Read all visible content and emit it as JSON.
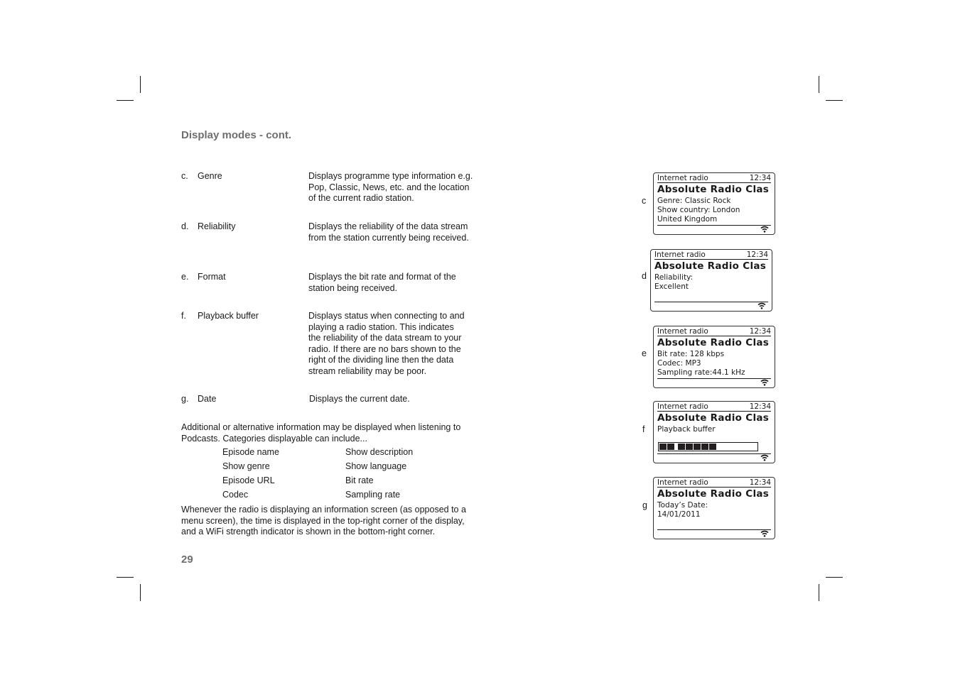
{
  "section_title": "Display modes - cont.",
  "entries": [
    {
      "letter": "c.",
      "term": "Genre",
      "description": "Displays programme type information e.g. Pop, Classic, News, etc. and the location of the current radio station."
    },
    {
      "letter": "d.",
      "term": "Reliability",
      "description": "Displays the reliability of the data stream from the station currently being received."
    },
    {
      "letter": "e.",
      "term": "Format",
      "description": "Displays the bit rate and format of the station being received."
    },
    {
      "letter": "f.",
      "term": "Playback buffer",
      "description": "Displays status when connecting to and playing a radio station. This indicates the reliability of the data stream to your radio. If there are no bars shown to the right of the dividing line then the data stream reliability may be poor."
    },
    {
      "letter": "g.",
      "term": "Date",
      "description": "Displays the current date."
    }
  ],
  "podcast_intro": "Additional or alternative information may be displayed when listening to Podcasts. Categories displayable can include...",
  "podcast_categories": [
    [
      "Episode name",
      "Show description"
    ],
    [
      "Show genre",
      "Show language"
    ],
    [
      "Episode URL",
      "Bit rate"
    ],
    [
      "Codec",
      "Sampling rate"
    ]
  ],
  "closing_paragraph": "Whenever the radio is displaying an information screen (as opposed to a menu screen), the time is displayed in the top-right corner of the display, and a WiFi strength indicator is shown in the bottom-right corner.",
  "page_number": "29",
  "displays": [
    {
      "label": "c",
      "source": "Internet radio",
      "time": "12:34",
      "station": "Absolute Radio Clas",
      "lines": [
        "Genre: Classic Rock",
        "Show country: London",
        "United Kingdom"
      ],
      "icon": "wifi-icon"
    },
    {
      "label": "d",
      "source": "Internet radio",
      "time": "12:34",
      "station": "Absolute Radio Clas",
      "lines": [
        "Reliability:",
        "Excellent"
      ],
      "icon": "wifi-icon"
    },
    {
      "label": "e",
      "source": "Internet radio",
      "time": "12:34",
      "station": "Absolute Radio Clas",
      "lines": [
        "Bit rate: 128 kbps",
        "Codec: MP3",
        "Sampling rate:44.1 kHz"
      ],
      "icon": "wifi-icon"
    },
    {
      "label": "f",
      "source": "Internet radio",
      "time": "12:34",
      "station": "Absolute Radio Clas",
      "lines": [
        "Playback buffer"
      ],
      "buffer_blocks_filled": 7,
      "buffer_fill_percent": 52,
      "icon": "wifi-icon"
    },
    {
      "label": "g",
      "source": "Internet radio",
      "time": "12:34",
      "station": "Absolute Radio Clas",
      "lines": [
        "Today’s Date:",
        "14/01/2011"
      ],
      "icon": "wifi-icon"
    }
  ]
}
